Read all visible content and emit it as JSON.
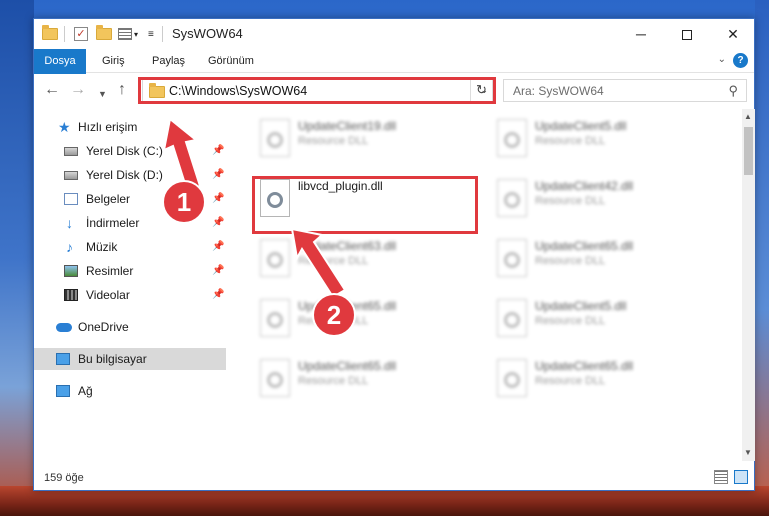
{
  "window": {
    "title": "SysWOW64",
    "controls": {
      "minimize": "─",
      "close": "✕"
    }
  },
  "ribbon": {
    "tabs": [
      {
        "label": "Dosya"
      },
      {
        "label": "Giriş"
      },
      {
        "label": "Paylaş"
      },
      {
        "label": "Görünüm"
      }
    ],
    "help": "?",
    "expand": "⌄"
  },
  "navbar": {
    "back": "←",
    "forward": "→",
    "recent": "▼",
    "up": "↑",
    "address": "C:\\Windows\\SysWOW64",
    "dropdown": "⌄",
    "refresh": "↻",
    "search_placeholder": "Ara: SysWOW64",
    "search_icon": "⚲"
  },
  "sidebar": {
    "items": [
      {
        "label": "Hızlı erişim",
        "icon": "star-icon"
      },
      {
        "label": "Yerel Disk (C:)",
        "icon": "disk-icon",
        "pinned": true
      },
      {
        "label": "Yerel Disk (D:)",
        "icon": "disk-icon",
        "pinned": true
      },
      {
        "label": "Belgeler",
        "icon": "documents-icon",
        "pinned": true
      },
      {
        "label": "İndirmeler",
        "icon": "download-icon",
        "pinned": true
      },
      {
        "label": "Müzik",
        "icon": "music-icon",
        "pinned": true
      },
      {
        "label": "Resimler",
        "icon": "pictures-icon",
        "pinned": true
      },
      {
        "label": "Videolar",
        "icon": "videos-icon",
        "pinned": true
      },
      {
        "label": "OneDrive",
        "icon": "cloud-icon"
      },
      {
        "label": "Bu bilgisayar",
        "icon": "computer-icon",
        "selected": true
      },
      {
        "label": "Ağ",
        "icon": "network-icon"
      }
    ],
    "pin_glyph": "📌"
  },
  "files": {
    "left": [
      {
        "name": "UpdateClient19.dll",
        "type": "Resource DLL"
      },
      {
        "name": "libvcd_plugin.dll",
        "type": ""
      },
      {
        "name": "UpdateClient63.dll",
        "type": "Resource DLL"
      },
      {
        "name": "UpdateClient65.dll",
        "type": "Resource DLL"
      },
      {
        "name": "UpdateClient65.dll",
        "type": "Resource DLL"
      }
    ],
    "right": [
      {
        "name": "UpdateClient5.dll",
        "type": "Resource DLL"
      },
      {
        "name": "UpdateClient42.dll",
        "type": "Resource DLL"
      },
      {
        "name": "UpdateClient65.dll",
        "type": "Resource DLL"
      },
      {
        "name": "UpdateClient5.dll",
        "type": "Resource DLL"
      },
      {
        "name": "UpdateClient65.dll",
        "type": "Resource DLL"
      }
    ]
  },
  "status": {
    "item_count": "159 öğe"
  },
  "annotations": {
    "step1": "1",
    "step2": "2",
    "color": "#e0393e"
  }
}
